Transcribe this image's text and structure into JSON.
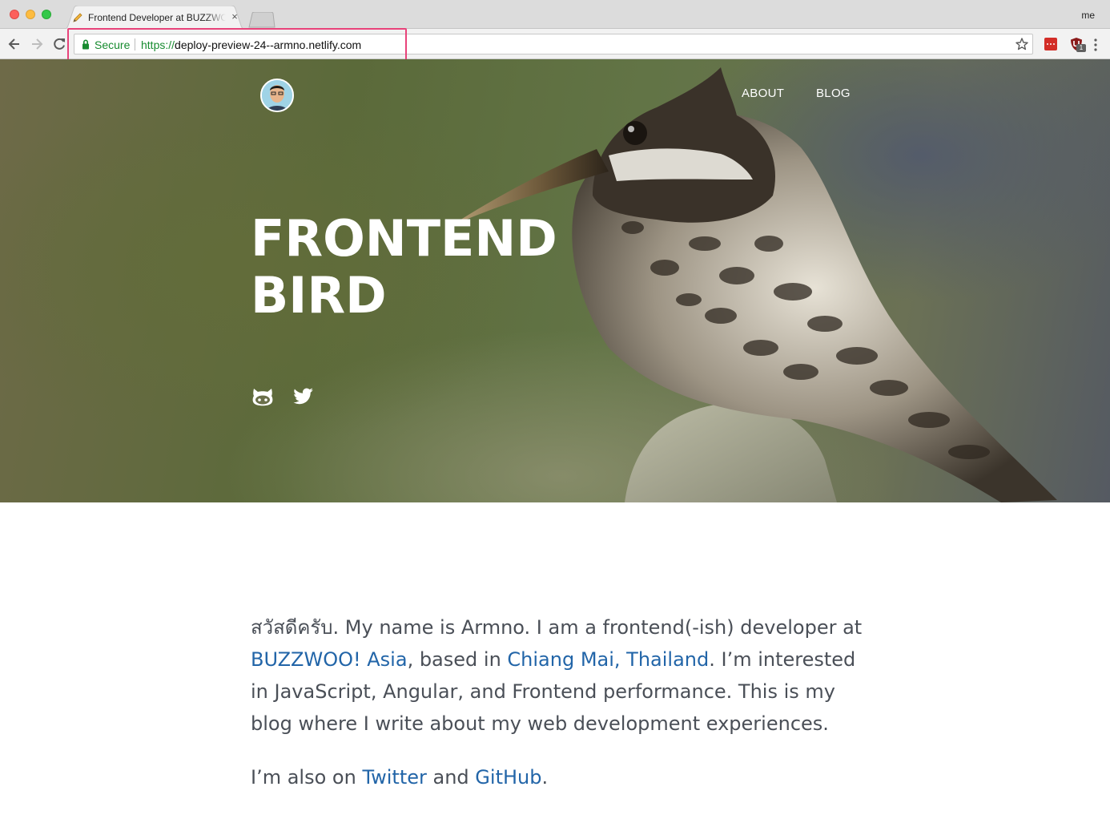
{
  "browser": {
    "tab_title": "Frontend Developer at BUZZWOO! Asia",
    "close_glyph": "×",
    "profile": "me",
    "secure_label": "Secure",
    "url_scheme": "https://",
    "url_host": "deploy-preview-24--armno.netlify.com",
    "extension_badge": "1",
    "highlight_color": "#e8437a"
  },
  "hero": {
    "nav": [
      {
        "label": "ABOUT"
      },
      {
        "label": "BLOG"
      }
    ],
    "title_line1": "FRONTEND",
    "title_line2": "BIRD",
    "social": [
      "github-icon",
      "twitter-icon"
    ]
  },
  "content": {
    "p1_part1": "สวัสดีครับ. My name is Armno. I am a frontend(-ish) developer at ",
    "link_company": "BUZZWOO! Asia",
    "p1_part2": ", based in ",
    "link_location": "Chiang Mai, Thailand",
    "p1_part3": ". I’m interested in JavaScript, Angular, and Frontend performance. This is my blog where I write about my web development experiences.",
    "p2_part1": "I’m also on ",
    "link_twitter": "Twitter",
    "p2_part2": " and ",
    "link_github": "GitHub",
    "p2_part3": "."
  },
  "colors": {
    "link": "#2265a8",
    "body_text": "#4a4f57",
    "secure_green": "#178b2f"
  }
}
